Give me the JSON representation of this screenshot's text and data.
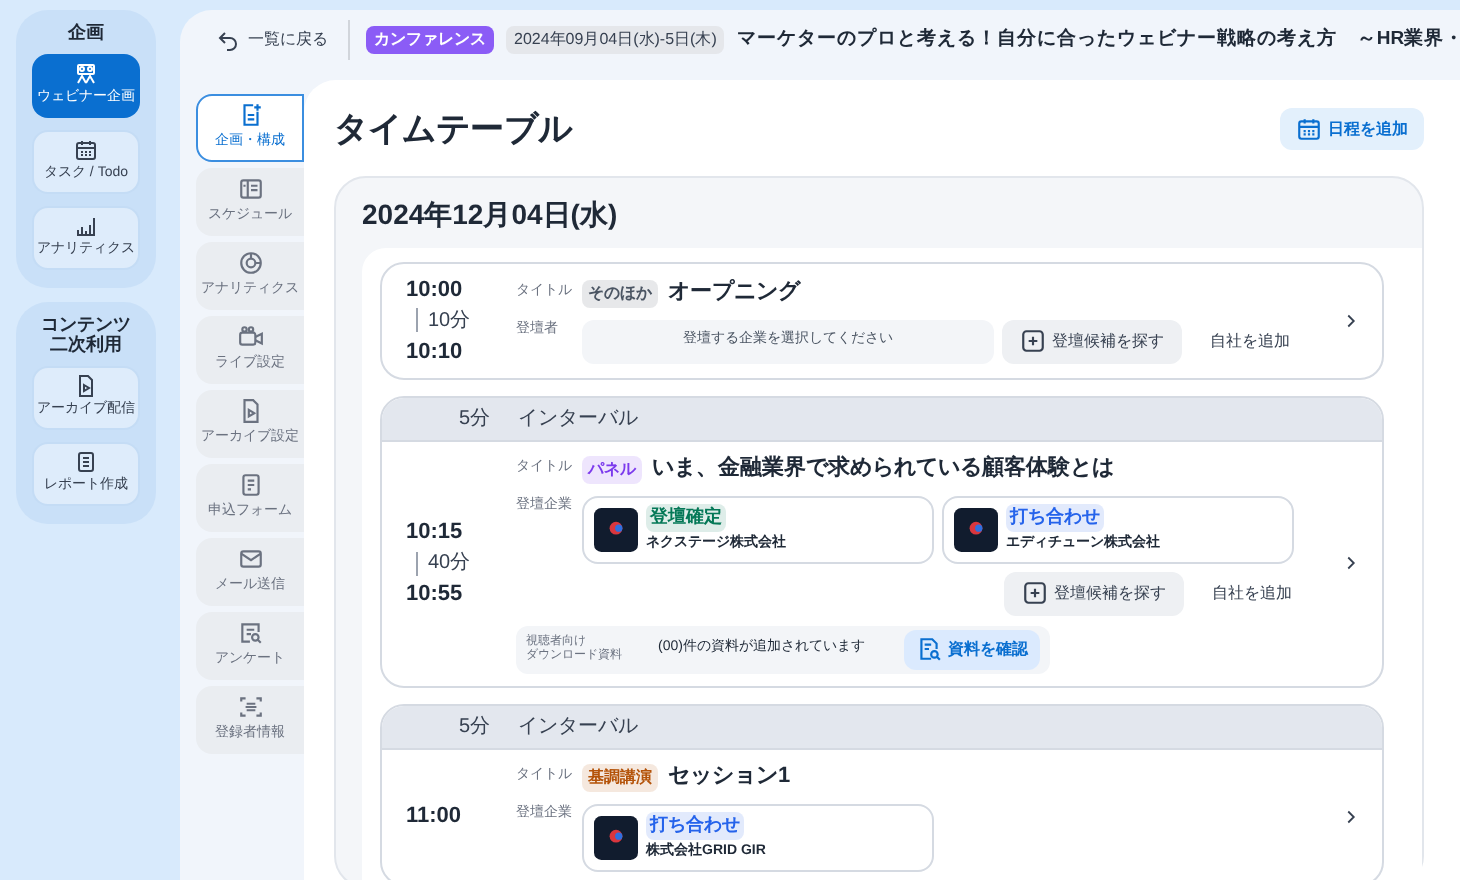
{
  "sidebar": {
    "groups": [
      {
        "title": "企画",
        "items": [
          {
            "label": "ウェビナー企画",
            "selected": true
          },
          {
            "label": "タスク / Todo",
            "selected": false
          },
          {
            "label": "アナリティクス",
            "selected": false
          }
        ]
      },
      {
        "title": "コンテンツ二次利用",
        "items": [
          {
            "label": "アーカイブ配信",
            "selected": false
          },
          {
            "label": "レポート作成",
            "selected": false
          }
        ]
      }
    ]
  },
  "header": {
    "back": "一覧に戻る",
    "category": "カンファレンス",
    "date": "2024年09月04日(水)-5日(木)",
    "title": "マーケターのプロと考える！自分に合ったウェビナー戦略の考え方　～HR業界・"
  },
  "subnav": [
    {
      "label": "企画・構成",
      "selected": true
    },
    {
      "label": "スケジュール",
      "selected": false
    },
    {
      "label": "アナリティクス",
      "selected": false
    },
    {
      "label": "ライブ設定",
      "selected": false
    },
    {
      "label": "アーカイブ設定",
      "selected": false
    },
    {
      "label": "申込フォーム",
      "selected": false
    },
    {
      "label": "メール送信",
      "selected": false
    },
    {
      "label": "アンケート",
      "selected": false
    },
    {
      "label": "登録者情報",
      "selected": false
    }
  ],
  "page_title": "タイムテーブル",
  "add_button": "日程を追加",
  "day": {
    "date": "2024年12月04日(水)",
    "entries": [
      {
        "start": "10:00",
        "duration": "10分",
        "end": "10:10",
        "title_label": "タイトル",
        "tag": {
          "text": "そのほか",
          "color": "#4b5563"
        },
        "title": "オープニング",
        "speaker_label": "登壇者",
        "speaker_placeholder": "登壇する企業を選択してください",
        "find_button": "登壇候補を探す",
        "add_self": "自社を追加"
      },
      {
        "interval": {
          "duration": "5分",
          "label": "インターバル"
        },
        "start": "10:15",
        "duration": "40分",
        "end": "10:55",
        "title_label": "タイトル",
        "tag": {
          "text": "パネル",
          "color": "#7c3aed"
        },
        "title": "いま、金融業界で求められている顧客体験とは",
        "speaker_label": "登壇企業",
        "companies": [
          {
            "status": "登壇確定",
            "color": "#047857",
            "name": "ネクステージ株式会社"
          },
          {
            "status": "打ち合わせ",
            "color": "#2563eb",
            "name": "エディチューン株式会社"
          }
        ],
        "find_button": "登壇候補を探す",
        "add_self": "自社を追加",
        "materials": {
          "label_lines": [
            "視聴者向け",
            "ダウンロード資料"
          ],
          "text": "(00)件の資料が追加されています",
          "button": "資料を確認"
        }
      },
      {
        "interval": {
          "duration": "5分",
          "label": "インターバル"
        },
        "start": "11:00",
        "title_label": "タイトル",
        "tag": {
          "text": "基調講演",
          "color": "#b45309"
        },
        "title": "セッション1",
        "speaker_label": "登壇企業",
        "companies": [
          {
            "status": "打ち合わせ",
            "color": "#2563eb",
            "name": "株式会社GRID GIR"
          }
        ]
      }
    ]
  }
}
